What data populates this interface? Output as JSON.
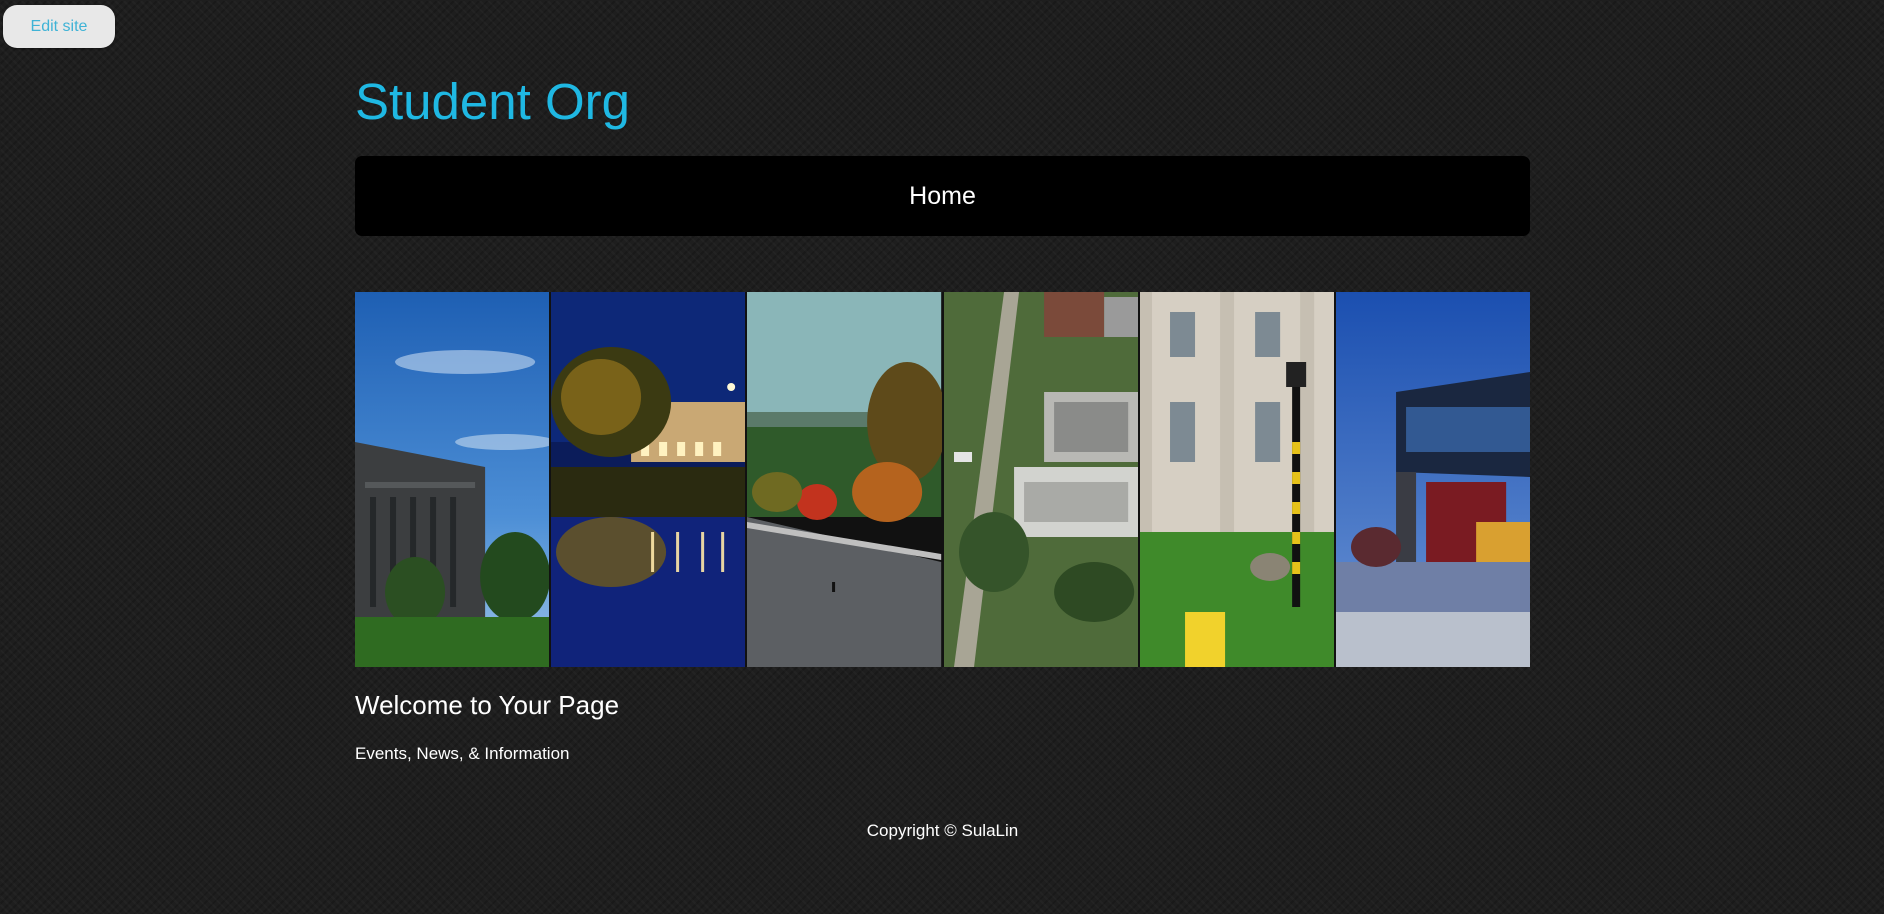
{
  "edit_button": {
    "label": "Edit site"
  },
  "site": {
    "title": "Student Org"
  },
  "nav": {
    "items": [
      {
        "label": "Home"
      }
    ]
  },
  "banner": {
    "panels": [
      {
        "icon": "campus-building-sky-photo"
      },
      {
        "icon": "night-reflection-photo"
      },
      {
        "icon": "autumn-street-photo"
      },
      {
        "icon": "aerial-campus-photo"
      },
      {
        "icon": "old-capitol-lamppost-photo"
      },
      {
        "icon": "modern-building-dusk-photo"
      }
    ]
  },
  "content": {
    "heading": "Welcome to Your Page",
    "subheading": "Events, News, & Information"
  },
  "footer": {
    "copyright": "Copyright © SulaLin"
  },
  "colors": {
    "accent": "#1fb8e3",
    "background": "#1e1e1e",
    "nav_background": "#000000"
  }
}
